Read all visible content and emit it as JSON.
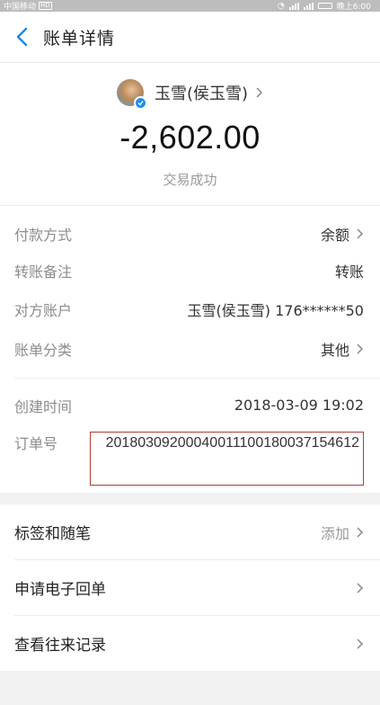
{
  "status_bar": {
    "carrier": "中国移动",
    "time": "晚上6:00"
  },
  "nav": {
    "title": "账单详情"
  },
  "summary": {
    "payee_name": "玉雪(侯玉雪)",
    "amount": "-2,602.00",
    "status": "交易成功"
  },
  "details": [
    {
      "label": "付款方式",
      "value": "余额"
    },
    {
      "label": "转账备注",
      "value": "转账"
    },
    {
      "label": "对方账户",
      "value": "玉雪(侯玉雪) 176******50"
    },
    {
      "label": "账单分类",
      "value": "其他"
    },
    {
      "label": "创建时间",
      "value": "2018-03-09 19:02"
    },
    {
      "label": "订单号",
      "value": "20180309200040011100180037154612"
    }
  ],
  "menu": [
    {
      "label": "标签和随笔",
      "action": "添加"
    },
    {
      "label": "申请电子回单"
    },
    {
      "label": "查看往来记录"
    }
  ]
}
